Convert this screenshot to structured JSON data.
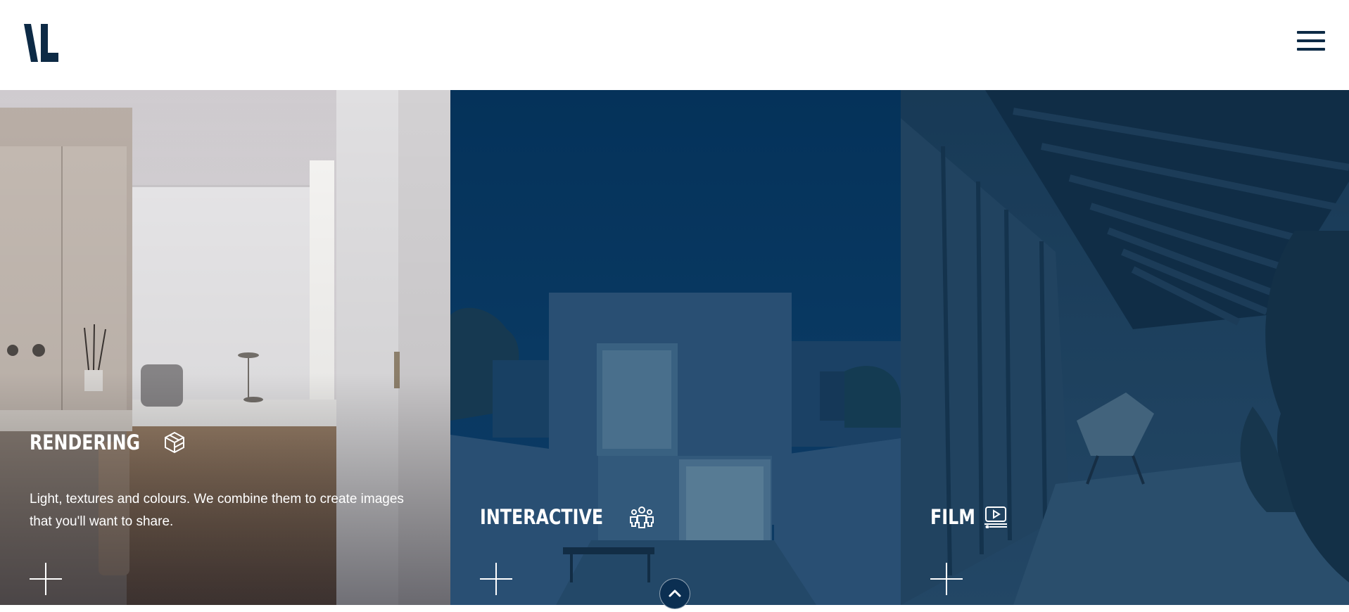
{
  "header": {
    "logo_alt": "VL",
    "menu_icon": "hamburger-menu-icon"
  },
  "panels": [
    {
      "title": "RENDERING",
      "icon": "cube-icon",
      "description": "Light, textures and colours. We combine them to create images that you'll want to share.",
      "action_icon": "plus-icon"
    },
    {
      "title": "INTERACTIVE",
      "icon": "people-group-icon",
      "action_icon": "plus-icon"
    },
    {
      "title": "FILM",
      "icon": "video-play-icon",
      "action_icon": "plus-icon"
    }
  ],
  "scroll_button": {
    "icon": "chevron-up-icon"
  },
  "colors": {
    "brand_navy": "#0d2a45",
    "interactive_overlay": "#06355c",
    "film_overlay": "#0d2e4a",
    "text": "#ffffff"
  }
}
